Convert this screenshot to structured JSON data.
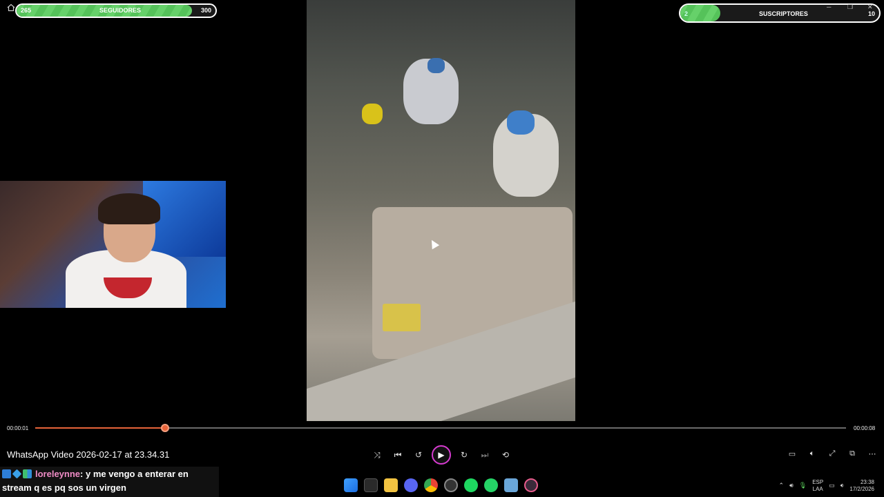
{
  "window": {
    "video_title": "WhatsApp Video 2026-02-17 at 23.34.31"
  },
  "overlay": {
    "followers": {
      "current": "265",
      "label": "SEGUIDORES",
      "goal": "300",
      "progress": 0.883
    },
    "subscribers": {
      "current": "2",
      "label": "SUSCRIPTORES",
      "goal": "10",
      "progress": 0.2
    }
  },
  "player": {
    "elapsed": "00:00:01",
    "total": "00:00:08",
    "progress": 0.16,
    "controls": [
      "shuffle-icon",
      "previous-icon",
      "rewind-10-icon",
      "play-icon",
      "forward-30-icon",
      "next-icon",
      "repeat-off-icon"
    ],
    "right_controls": [
      "subtitles-icon",
      "volume-icon",
      "fullscreen-icon",
      "mini-player-icon",
      "more-icon"
    ],
    "accent": "#e8643a",
    "play_ring": "#d63bd0"
  },
  "chat": {
    "username": "loreleynne",
    "message_part1": ": y me vengo a enterar en",
    "message_part2": "stream q es pq sos un virgen",
    "username_color": "#f08cc6"
  },
  "taskbar": {
    "apps": [
      "start-icon",
      "store-icon",
      "file-explorer-icon",
      "discord-icon",
      "chrome-icon",
      "obs-icon",
      "spotify-icon",
      "whatsapp-icon",
      "photos-icon",
      "media-player-icon"
    ],
    "lang_top": "ESP",
    "lang_bottom": "LAA",
    "time": "23:38",
    "date": "17/2/2026"
  }
}
